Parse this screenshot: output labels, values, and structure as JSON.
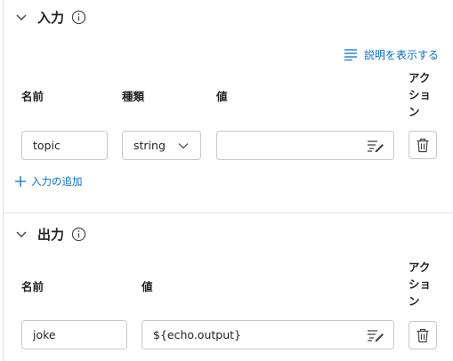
{
  "input_section": {
    "title": "入力",
    "show_description": "説明を表示する",
    "columns": {
      "name": "名前",
      "type": "種類",
      "value": "値",
      "action": "アクション"
    },
    "rows": [
      {
        "name": "topic",
        "type": "string",
        "value": ""
      }
    ],
    "add_label": "入力の追加"
  },
  "output_section": {
    "title": "出力",
    "columns": {
      "name": "名前",
      "value": "値",
      "action": "アクション"
    },
    "rows": [
      {
        "name": "joke",
        "value": "${echo.output}"
      }
    ]
  },
  "colors": {
    "accent": "#0f6cbd",
    "border": "#c8c8c8",
    "divider": "#e1e1e1"
  },
  "icons": [
    "chevron-down-icon",
    "info-icon",
    "list-lines-icon",
    "edit-text-icon",
    "trash-icon",
    "plus-icon"
  ]
}
